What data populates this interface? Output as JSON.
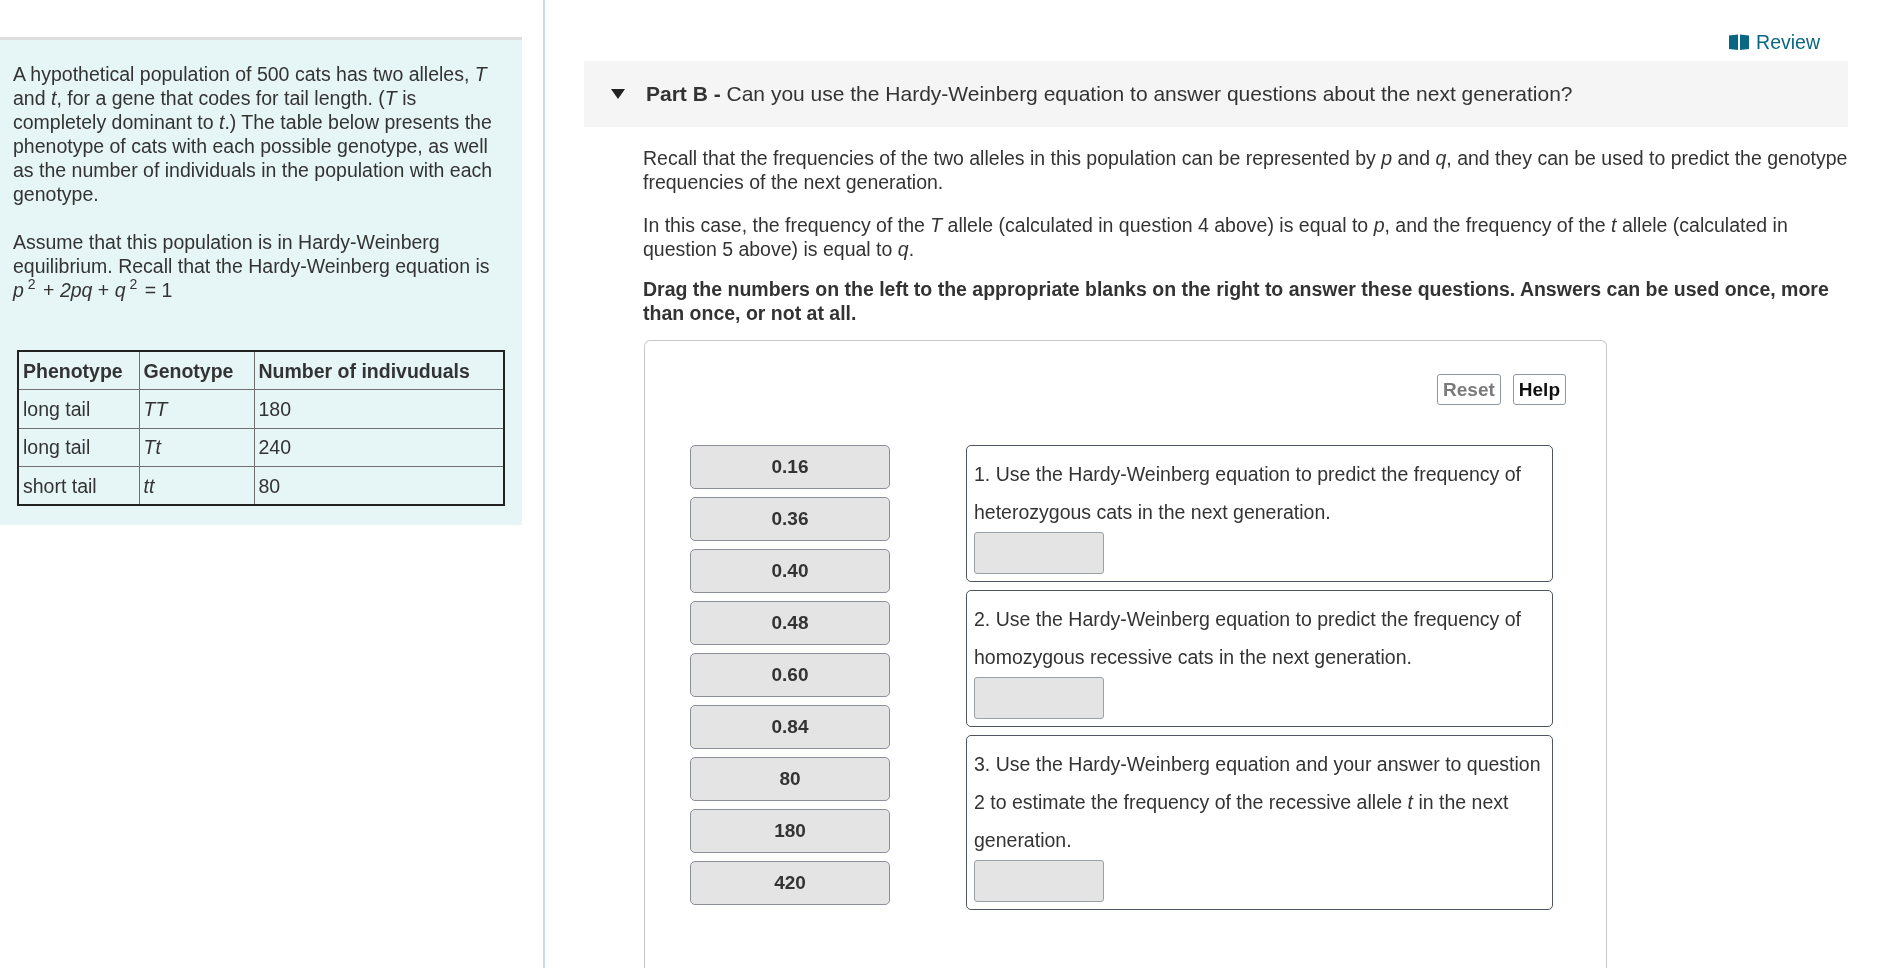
{
  "intro": {
    "paragraphs": [
      "A hypothetical population of 500 cats has two alleles, *T* and *t*, for a gene that codes for tail length. (*T* is completely dominant to *t*.) The table below presents the phenotype of cats with each possible genotype, as well as the number of individuals in the population with each genotype.",
      "Assume that this population is in Hardy-Weinberg equilibrium. Recall that the Hardy-Weinberg equation is *p*$^{2}$ + *2pq* + *q*$^{2}$ = 1"
    ],
    "table": {
      "columns": [
        "Phenotype",
        "Genotype",
        "Number of indivuduals"
      ],
      "rows": [
        {
          "phenotype": "long tail",
          "genotype": "TT",
          "number": "180"
        },
        {
          "phenotype": "long tail",
          "genotype": "Tt",
          "number": "240"
        },
        {
          "phenotype": "short tail",
          "genotype": "tt",
          "number": "80"
        }
      ]
    }
  },
  "review_link": {
    "label": "Review"
  },
  "part": {
    "title": "**Part B -** Can you use the Hardy-Weinberg equation to answer questions about the next generation?",
    "expanded": true,
    "paragraphs": [
      "Recall that the frequencies of the two alleles in this population can be represented by *p* and *q*, and they can be used to predict the genotype frequencies of the next generation.",
      "In this case, the frequency of the *T* allele (calculated in question 4 above) is equal to *p*, and the frequency of the *t* allele (calculated in question 5 above) is equal to *q*."
    ],
    "directions": "Drag the numbers on the left to the appropriate blanks on the right to answer these questions. Answers can be used once, more than once, or not at all.",
    "activity": {
      "buttons": [
        {
          "label": "Reset",
          "disabled": true
        },
        {
          "label": "Help",
          "disabled": false
        }
      ],
      "tiles": [
        "0.16",
        "0.36",
        "0.40",
        "0.48",
        "0.60",
        "0.84",
        "80",
        "180",
        "420"
      ],
      "questions": [
        {
          "text": "1. Use the Hardy-Weinberg equation to predict the frequency of heterozygous cats in the next generation."
        },
        {
          "text": "2. Use the Hardy-Weinberg equation to predict the frequency of homozygous recessive cats in the next generation."
        },
        {
          "text": "3. Use the Hardy-Weinberg equation and your answer to question 2 to estimate the frequency of the recessive allele *t* in the next generation."
        }
      ]
    }
  }
}
